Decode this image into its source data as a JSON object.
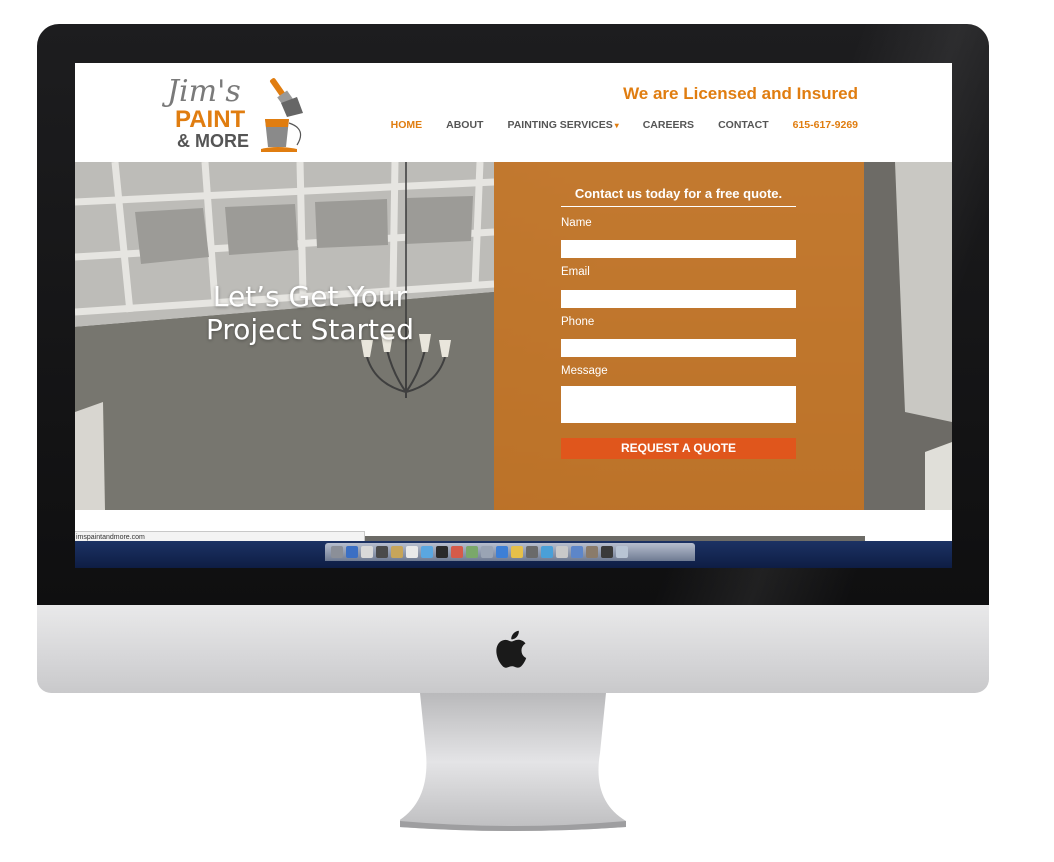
{
  "site": {
    "logo": {
      "script": "Jim's",
      "line1": "PAINT",
      "line2": "& MORE"
    },
    "tagline": "We are Licensed and Insured",
    "nav": [
      {
        "label": "HOME",
        "active": true
      },
      {
        "label": "ABOUT"
      },
      {
        "label": "PAINTING SERVICES",
        "has_dropdown": true
      },
      {
        "label": "CAREERS"
      },
      {
        "label": "CONTACT"
      },
      {
        "label": "615-617-9269",
        "is_phone": true
      }
    ],
    "dropdown_caret": "▾"
  },
  "hero": {
    "title": "Let’s Get Your Project Started"
  },
  "quote_form": {
    "heading": "Contact us today for a free quote.",
    "fields": [
      {
        "label": "Name",
        "value": ""
      },
      {
        "label": "Email",
        "value": ""
      },
      {
        "label": "Phone",
        "value": ""
      },
      {
        "label": "Message",
        "value": ""
      }
    ],
    "submit_label": "REQUEST A QUOTE"
  },
  "browser": {
    "status_url": "imspaintandmore.com"
  },
  "colors": {
    "accent_orange": "#e07d10",
    "panel_orange": "#cd7823",
    "button_orange": "#e0561c",
    "nav_gray": "#555555"
  },
  "icons": [
    "apple-logo-icon",
    "paintbrush-icon",
    "paint-bucket-icon",
    "dropdown-caret-icon"
  ]
}
